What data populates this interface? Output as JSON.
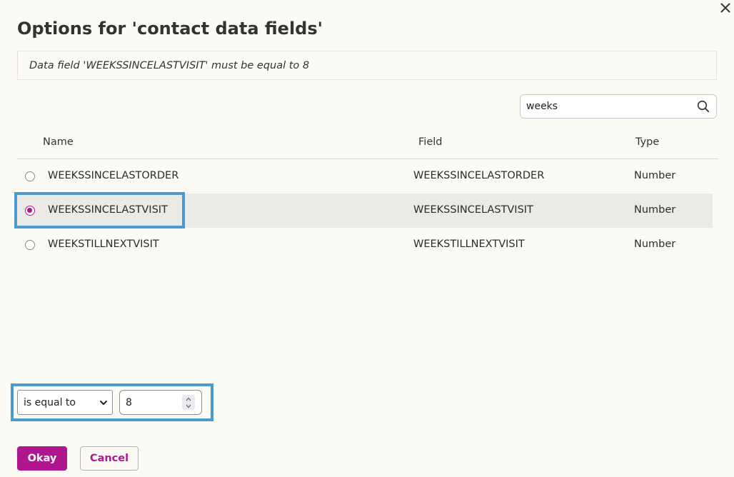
{
  "dialog": {
    "title": "Options for 'contact data fields'",
    "summary": "Data field 'WEEKSSINCELASTVISIT' must be equal to 8"
  },
  "search": {
    "value": "weeks",
    "icon": "search-icon"
  },
  "table": {
    "headers": {
      "name": "Name",
      "field": "Field",
      "type": "Type"
    },
    "rows": [
      {
        "name": "WEEKSSINCELASTORDER",
        "field": "WEEKSSINCELASTORDER",
        "type": "Number",
        "selected": false
      },
      {
        "name": "WEEKSSINCELASTVISIT",
        "field": "WEEKSSINCELASTVISIT",
        "type": "Number",
        "selected": true
      },
      {
        "name": "WEEKSTILLNEXTVISIT",
        "field": "WEEKSTILLNEXTVISIT",
        "type": "Number",
        "selected": false
      }
    ]
  },
  "condition": {
    "operator": "is equal to",
    "value": "8"
  },
  "footer": {
    "okay_label": "Okay",
    "cancel_label": "Cancel"
  },
  "colors": {
    "accent": "#b0178f",
    "highlight": "#4a9acd",
    "background": "#fbfaf5",
    "selected_row": "#eceae6"
  }
}
